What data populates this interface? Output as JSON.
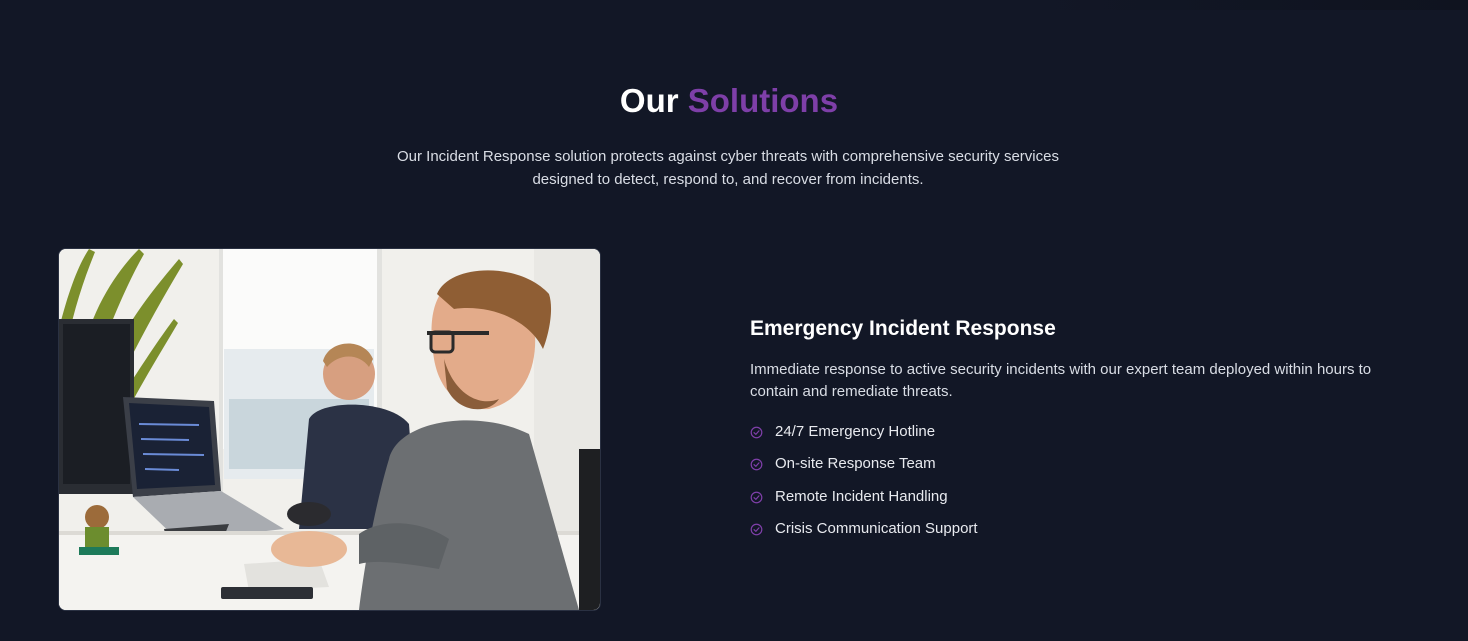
{
  "header": {
    "title_part1": "Our",
    "title_part2": "Solutions",
    "description": "Our Incident Response solution protects against cyber threats with comprehensive security services designed to detect, respond to, and recover from incidents."
  },
  "feature": {
    "title": "Emergency Incident Response",
    "description": "Immediate response to active security incidents with our expert team deployed within hours to contain and remediate threats.",
    "items": [
      {
        "label": "24/7 Emergency Hotline",
        "icon": "check-circle-icon"
      },
      {
        "label": "On-site Response Team",
        "icon": "check-circle-icon"
      },
      {
        "label": "Remote Incident Handling",
        "icon": "check-circle-icon"
      },
      {
        "label": "Crisis Communication Support",
        "icon": "check-circle-icon"
      }
    ]
  },
  "colors": {
    "background": "#121726",
    "accent": "#7e3fa8",
    "heading": "#ffffff",
    "body_text": "#d9dde5"
  }
}
